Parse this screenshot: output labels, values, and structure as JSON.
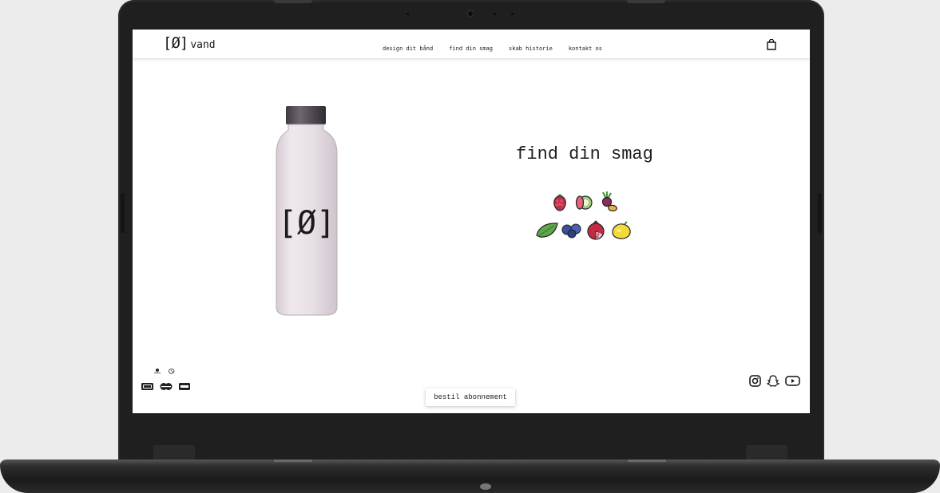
{
  "site": {
    "logo_mark": "[Ø]",
    "logo_text": "vand"
  },
  "nav": {
    "items": [
      {
        "label": "design dit bånd"
      },
      {
        "label": "find din smag"
      },
      {
        "label": "skab historie"
      },
      {
        "label": "kontakt os"
      }
    ]
  },
  "hero": {
    "title": "find din smag",
    "bottle_label": "[Ø]"
  },
  "flavors": [
    "raspberry-icon",
    "kiwi-icon",
    "beet-ginger-icon",
    "leaf-icon",
    "blueberry-icon",
    "pomegranate-icon",
    "lemon-icon"
  ],
  "footer": {
    "subscribe_label": "bestil abonnement",
    "payment_icons": [
      "dankort-icon",
      "mastercard-icon",
      "visa-icon",
      "mobilepay-icon",
      "applepay-icon"
    ],
    "social_icons": [
      "instagram-icon",
      "snapchat-icon",
      "youtube-icon"
    ]
  },
  "colors": {
    "bottle_cap": "#5b5560",
    "bottle_body": "#e6dfe6",
    "text": "#1d1d1d"
  }
}
